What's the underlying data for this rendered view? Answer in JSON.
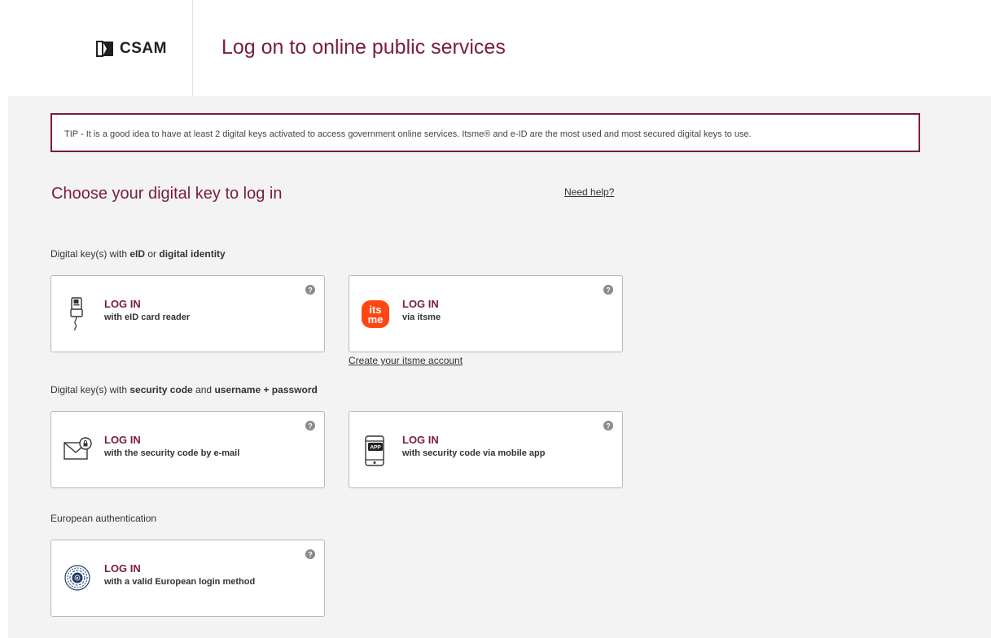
{
  "header": {
    "logo_text": "CSAM",
    "title": "Log on to online public services"
  },
  "tip": "TIP - It is a good idea to have at least 2 digital keys activated to access government online services. Itsme® and e-ID are the most used and most secured digital keys to use.",
  "choose_title": "Choose your digital key to log in",
  "need_help": "Need help?",
  "sections": {
    "eid": {
      "prefix": "Digital key(s) with ",
      "b1": "eID",
      "mid": " or ",
      "b2": "digital identity"
    },
    "code": {
      "prefix": "Digital key(s) with ",
      "b1": "security code",
      "mid": " and ",
      "b2": "username + password"
    },
    "european": {
      "label": "European authentication"
    }
  },
  "cards": {
    "eid_reader": {
      "title": "LOG IN",
      "subtitle": "with eID card reader",
      "icon": "card-reader-icon"
    },
    "itsme": {
      "title": "LOG IN",
      "subtitle": "via itsme",
      "icon": "itsme-logo-icon",
      "logo_line1": "its",
      "logo_line2": "me"
    },
    "email_code": {
      "title": "LOG IN",
      "subtitle": "with the security code by e-mail",
      "icon": "email-lock-icon"
    },
    "mobile_app": {
      "title": "LOG IN",
      "subtitle": "with security code via mobile app",
      "icon": "mobile-app-icon",
      "app_label": "APP"
    },
    "european": {
      "title": "LOG IN",
      "subtitle": "with a valid European login method",
      "icon": "fingerprint-icon"
    }
  },
  "itsme_create_link": "Create your itsme account",
  "colors": {
    "brand": "#7b1c3e",
    "itsme": "#ff4612",
    "background": "#f3f3f3"
  }
}
